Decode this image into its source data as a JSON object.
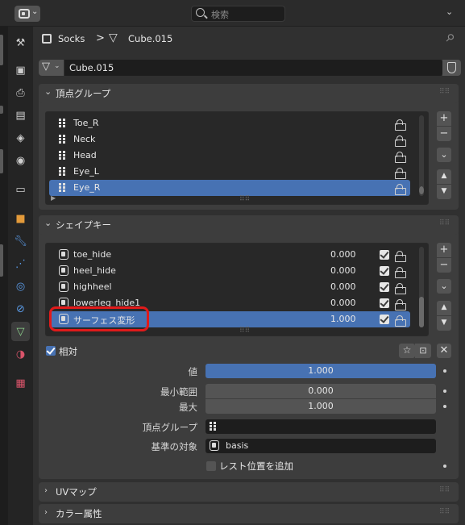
{
  "header": {
    "search_placeholder": "検索",
    "editor_type_icon": "properties-editor-icon"
  },
  "breadcrumb": {
    "object_name": "Socks",
    "separator": ">",
    "mesh_name": "Cube.015"
  },
  "mesh_datablock": {
    "name": "Cube.015"
  },
  "vertex_groups": {
    "title": "頂点グループ",
    "items": [
      {
        "name": "Toe_R",
        "selected": false
      },
      {
        "name": "Neck",
        "selected": false
      },
      {
        "name": "Head",
        "selected": false
      },
      {
        "name": "Eye_L",
        "selected": false
      },
      {
        "name": "Eye_R",
        "selected": true
      }
    ],
    "buttons": {
      "add": "+",
      "remove": "−",
      "menu": "⌄",
      "up": "▲",
      "down": "▼"
    }
  },
  "shape_keys": {
    "title": "シェイプキー",
    "items": [
      {
        "name": "toe_hide",
        "value": "0.000",
        "selected": false
      },
      {
        "name": "heel_hide",
        "value": "0.000",
        "selected": false
      },
      {
        "name": "highheel",
        "value": "0.000",
        "selected": false
      },
      {
        "name": "lowerleg_hide1",
        "value": "0.000",
        "selected": false
      },
      {
        "name": "サーフェス変形",
        "value": "1.000",
        "selected": true
      }
    ],
    "relative_label": "相対",
    "relative_checked": true,
    "value_label": "値",
    "value": "1.000",
    "range_min_label": "最小範囲",
    "range_min": "0.000",
    "max_label": "最大",
    "max": "1.000",
    "vertex_group_label": "頂点グループ",
    "vertex_group_value": "",
    "relative_to_label": "基準の対象",
    "relative_to_value": "basis",
    "rest_position_label": "レスト位置を追加",
    "rest_position_checked": false
  },
  "collapsed_panels": {
    "uv_maps": "UVマップ",
    "color_attributes": "カラー属性"
  },
  "colors": {
    "accent": "#4772b3",
    "highlight_box": "#e01a1a",
    "active_tab_icon": "#8ed48e"
  }
}
